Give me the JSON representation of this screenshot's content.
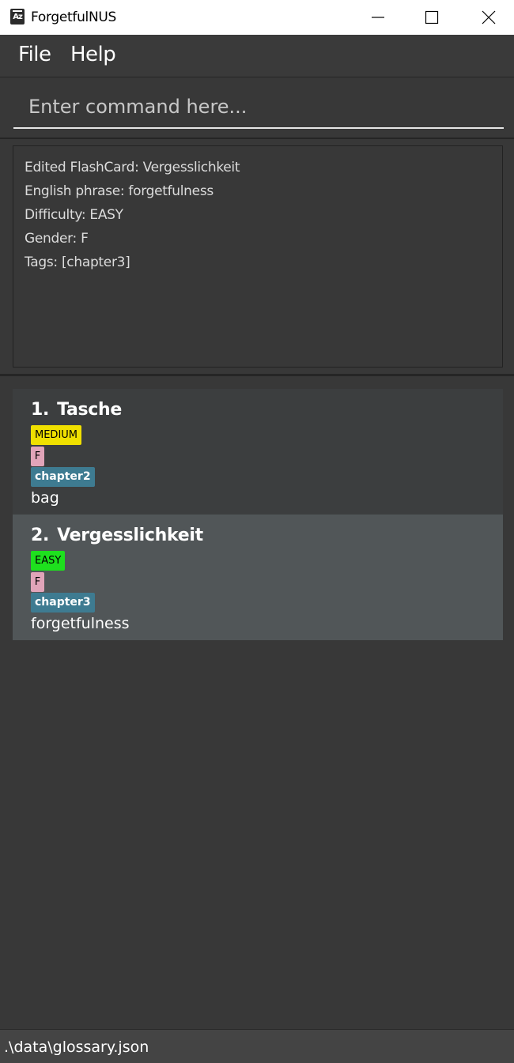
{
  "window": {
    "title": "ForgetfulNUS",
    "icon": "az-app-icon",
    "controls": [
      "minimize-icon",
      "maximize-icon",
      "close-icon"
    ]
  },
  "menu": {
    "file_label": "File",
    "help_label": "Help"
  },
  "command": {
    "value": "",
    "placeholder": "Enter command here..."
  },
  "result": {
    "lines": [
      "Edited FlashCard: Vergesslichkeit",
      "English phrase: forgetfulness",
      "Difficulty: EASY",
      "Gender: F",
      "Tags: [chapter3]"
    ]
  },
  "flashcards": [
    {
      "index": "1.",
      "german": "Tasche",
      "difficulty": "MEDIUM",
      "difficulty_color": "#f0e000",
      "gender": "F",
      "tag": "chapter2",
      "english": "bag"
    },
    {
      "index": "2.",
      "german": "Vergesslichkeit",
      "difficulty": "EASY",
      "difficulty_color": "#1ee01e",
      "gender": "F",
      "tag": "chapter3",
      "english": "forgetfulness"
    }
  ],
  "status": {
    "path": ".\\data\\glossary.json"
  },
  "colors": {
    "background": "#383838",
    "selected_card": "#515658",
    "tag": "#3e7b91",
    "gender": "#e1a4b9"
  }
}
